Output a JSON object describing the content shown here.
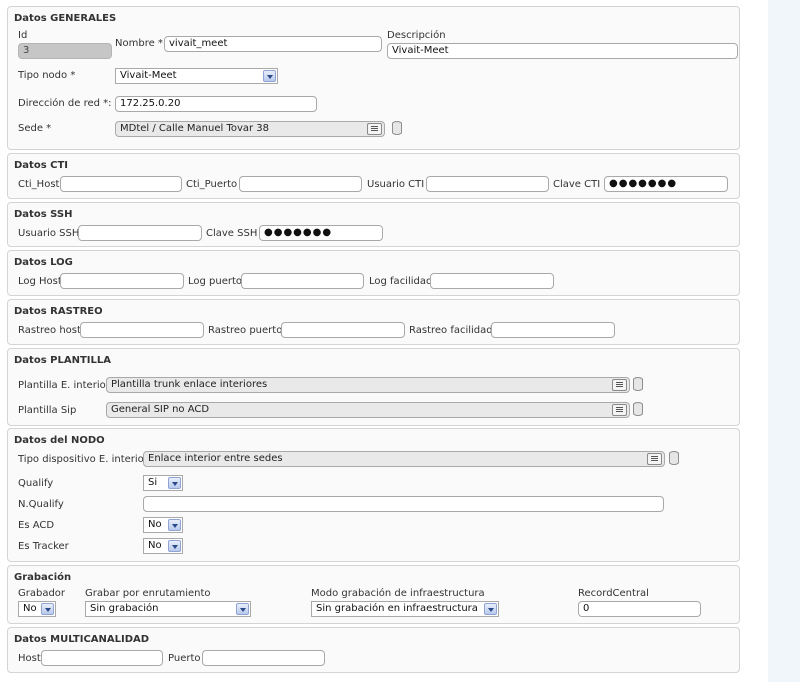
{
  "generales": {
    "title": "Datos GENERALES",
    "id_label": "Id",
    "id_value": "3",
    "nombre_label": "Nombre *",
    "nombre_value": "vivait_meet",
    "descripcion_label": "Descripción",
    "descripcion_value": "Vivait-Meet",
    "tipo_label": "Tipo nodo *",
    "tipo_value": "Vivait-Meet",
    "direccion_label": "Dirección de red *:",
    "direccion_value": "172.25.0.20",
    "sede_label": "Sede *",
    "sede_value": "MDtel / Calle Manuel Tovar 38"
  },
  "cti": {
    "title": "Datos CTI",
    "host_label": "Cti_Host",
    "puerto_label": "Cti_Puerto",
    "usuario_label": "Usuario CTI",
    "clave_label": "Clave CTI",
    "clave_value": "●●●●●●●"
  },
  "ssh": {
    "title": "Datos SSH",
    "usuario_label": "Usuario SSH",
    "clave_label": "Clave SSH",
    "clave_value": "●●●●●●●"
  },
  "log": {
    "title": "Datos LOG",
    "host_label": "Log Host",
    "puerto_label": "Log puerto",
    "facilidad_label": "Log facilidad"
  },
  "rastreo": {
    "title": "Datos RASTREO",
    "host_label": "Rastreo host",
    "puerto_label": "Rastreo puerto",
    "facilidad_label": "Rastreo facilidad"
  },
  "plantilla": {
    "title": "Datos PLANTILLA",
    "interior_label": "Plantilla E. interior",
    "interior_value": "Plantilla trunk enlace interiores",
    "sip_label": "Plantilla Sip",
    "sip_value": "General SIP no ACD"
  },
  "nodo": {
    "title": "Datos del NODO",
    "tipo_label": "Tipo dispositivo E. interior",
    "tipo_value": "Enlace interior entre sedes",
    "qualify_label": "Qualify",
    "qualify_value": "Si",
    "nqualify_label": "N.Qualify",
    "acd_label": "Es ACD",
    "acd_value": "No",
    "tracker_label": "Es Tracker",
    "tracker_value": "No"
  },
  "grabacion": {
    "title": "Grabación",
    "grabador_label": "Grabador",
    "grabador_value": "No",
    "enrutamiento_label": "Grabar por enrutamiento",
    "enrutamiento_value": "Sin grabación",
    "modo_label": "Modo grabación de infraestructura",
    "modo_value": "Sin grabación en infraestructura",
    "record_label": "RecordCentral",
    "record_value": "0"
  },
  "multicanal": {
    "title": "Datos MULTICANALIDAD",
    "host_label": "Host",
    "puerto_label": "Puerto"
  }
}
